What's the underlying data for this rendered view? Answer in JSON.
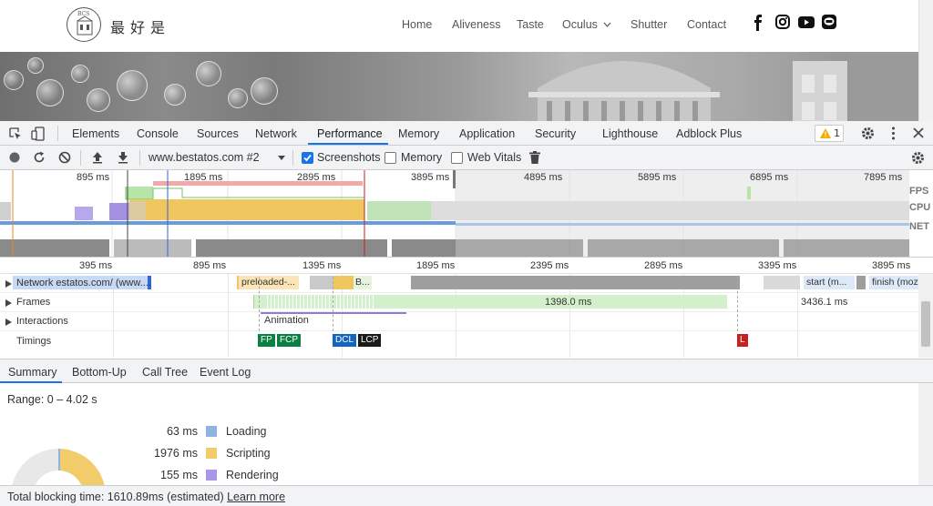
{
  "site": {
    "brand": "最好是",
    "logo_text": "BCS",
    "nav": [
      "Home",
      "Aliveness",
      "Taste",
      "Oculus",
      "Shutter",
      "Contact"
    ],
    "nav_dropdown_index": 3,
    "social_icons": [
      "facebook-icon",
      "instagram-icon",
      "youtube-icon",
      "line-icon"
    ]
  },
  "devtools": {
    "tabs": [
      "Elements",
      "Console",
      "Sources",
      "Network",
      "Performance",
      "Memory",
      "Application",
      "Security",
      "Lighthouse",
      "Adblock Plus"
    ],
    "active_tab": "Performance",
    "warning_count": "1",
    "toolbar": {
      "profile_select": "www.bestatos.com #2",
      "screenshots_label": "Screenshots",
      "screenshots_checked": true,
      "memory_label": "Memory",
      "memory_checked": false,
      "webvitals_label": "Web Vitals",
      "webvitals_checked": false
    },
    "overview": {
      "ticks": [
        "895 ms",
        "1895 ms",
        "2895 ms",
        "3895 ms",
        "4895 ms",
        "5895 ms",
        "6895 ms",
        "7895 ms"
      ],
      "labels": [
        "FPS",
        "CPU",
        "NET"
      ]
    },
    "ruler_ticks": [
      "395 ms",
      "895 ms",
      "1395 ms",
      "1895 ms",
      "2395 ms",
      "2895 ms",
      "3395 ms",
      "3895 ms"
    ],
    "tracks": {
      "network": {
        "label": "Network estatos.com/ (www....",
        "items": [
          "preloaded-...",
          "B...",
          "start (m...",
          "finish (moz"
        ]
      },
      "frames": {
        "label": "Frames",
        "items": [
          "1398.0 ms",
          "3436.1 ms"
        ]
      },
      "interactions": {
        "label": "Interactions",
        "items": [
          "Animation"
        ]
      },
      "timings": {
        "label": "Timings",
        "markers": [
          {
            "text": "FP",
            "color": "#0b8043"
          },
          {
            "text": "FCP",
            "color": "#0b8043"
          },
          {
            "text": "DCL",
            "color": "#1565c0"
          },
          {
            "text": "LCP",
            "color": "#1a1a1a"
          },
          {
            "text": "L",
            "color": "#c5221f"
          }
        ]
      }
    },
    "bottom_tabs": [
      "Summary",
      "Bottom-Up",
      "Call Tree",
      "Event Log"
    ],
    "active_bottom_tab": "Summary",
    "summary": {
      "range": "Range: 0 – 4.02 s",
      "rows": [
        {
          "ms": "63 ms",
          "name": "Loading",
          "color": "#8fb4e3"
        },
        {
          "ms": "1976 ms",
          "name": "Scripting",
          "color": "#f2cc6b"
        },
        {
          "ms": "155 ms",
          "name": "Rendering",
          "color": "#a998e8"
        }
      ]
    },
    "status": {
      "text": "Total blocking time: 1610.89ms (estimated)",
      "link": "Learn more"
    }
  }
}
